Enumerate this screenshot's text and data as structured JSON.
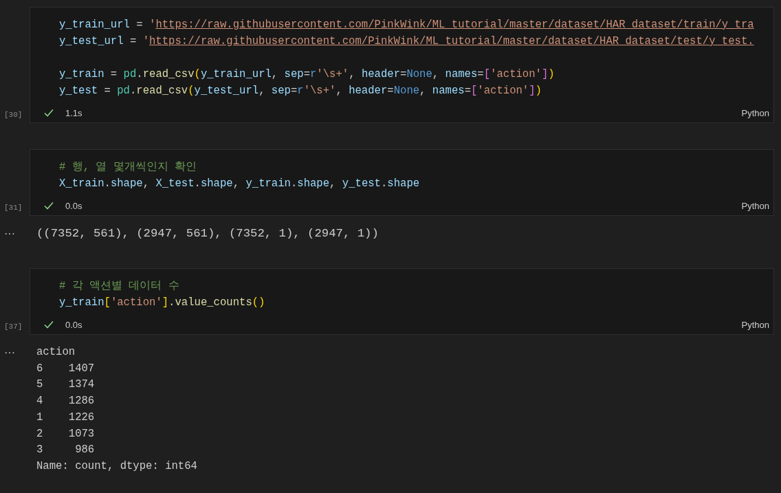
{
  "cells": [
    {
      "execution_count": "[30]",
      "lines": [
        {
          "kind": "code",
          "tokens": [
            {
              "kind": "var",
              "t": "y_train_url"
            },
            {
              "kind": "op",
              "t": " = "
            },
            {
              "kind": "str",
              "t": "'"
            },
            {
              "kind": "link",
              "t": "https://raw.githubusercontent.com/PinkWink/ML_tutorial/master/dataset/HAR_dataset/train/y_tra"
            }
          ]
        },
        {
          "kind": "code",
          "tokens": [
            {
              "kind": "var",
              "t": "y_test_url"
            },
            {
              "kind": "op",
              "t": " = "
            },
            {
              "kind": "str",
              "t": "'"
            },
            {
              "kind": "link",
              "t": "https://raw.githubusercontent.com/PinkWink/ML_tutorial/master/dataset/HAR_dataset/test/y_test."
            }
          ]
        },
        {
          "kind": "blank"
        },
        {
          "kind": "code",
          "tokens": [
            {
              "kind": "var",
              "t": "y_train"
            },
            {
              "kind": "op",
              "t": " = "
            },
            {
              "kind": "type",
              "t": "pd"
            },
            {
              "kind": "op",
              "t": "."
            },
            {
              "kind": "func",
              "t": "read_csv"
            },
            {
              "kind": "b1",
              "t": "("
            },
            {
              "kind": "var",
              "t": "y_train_url"
            },
            {
              "kind": "op",
              "t": ", "
            },
            {
              "kind": "var",
              "t": "sep"
            },
            {
              "kind": "op",
              "t": "="
            },
            {
              "kind": "kw",
              "t": "r"
            },
            {
              "kind": "str",
              "t": "'\\s+'"
            },
            {
              "kind": "op",
              "t": ", "
            },
            {
              "kind": "var",
              "t": "header"
            },
            {
              "kind": "op",
              "t": "="
            },
            {
              "kind": "kw",
              "t": "None"
            },
            {
              "kind": "op",
              "t": ", "
            },
            {
              "kind": "var",
              "t": "names"
            },
            {
              "kind": "op",
              "t": "="
            },
            {
              "kind": "b2",
              "t": "["
            },
            {
              "kind": "str",
              "t": "'action'"
            },
            {
              "kind": "b2",
              "t": "]"
            },
            {
              "kind": "b1",
              "t": ")"
            }
          ]
        },
        {
          "kind": "code",
          "tokens": [
            {
              "kind": "var",
              "t": "y_test"
            },
            {
              "kind": "op",
              "t": " = "
            },
            {
              "kind": "type",
              "t": "pd"
            },
            {
              "kind": "op",
              "t": "."
            },
            {
              "kind": "func",
              "t": "read_csv"
            },
            {
              "kind": "b1",
              "t": "("
            },
            {
              "kind": "var",
              "t": "y_test_url"
            },
            {
              "kind": "op",
              "t": ", "
            },
            {
              "kind": "var",
              "t": "sep"
            },
            {
              "kind": "op",
              "t": "="
            },
            {
              "kind": "kw",
              "t": "r"
            },
            {
              "kind": "str",
              "t": "'\\s+'"
            },
            {
              "kind": "op",
              "t": ", "
            },
            {
              "kind": "var",
              "t": "header"
            },
            {
              "kind": "op",
              "t": "="
            },
            {
              "kind": "kw",
              "t": "None"
            },
            {
              "kind": "op",
              "t": ", "
            },
            {
              "kind": "var",
              "t": "names"
            },
            {
              "kind": "op",
              "t": "="
            },
            {
              "kind": "b2",
              "t": "["
            },
            {
              "kind": "str",
              "t": "'action'"
            },
            {
              "kind": "b2",
              "t": "]"
            },
            {
              "kind": "b1",
              "t": ")"
            }
          ]
        }
      ],
      "succeeded": true,
      "duration": "1.1s",
      "language": "Python"
    },
    {
      "execution_count": "[31]",
      "lines": [
        {
          "kind": "code",
          "tokens": [
            {
              "kind": "comment",
              "t": "# 행, 열 몇개씩인지 확인"
            }
          ]
        },
        {
          "kind": "code",
          "tokens": [
            {
              "kind": "var",
              "t": "X_train"
            },
            {
              "kind": "op",
              "t": "."
            },
            {
              "kind": "var",
              "t": "shape"
            },
            {
              "kind": "op",
              "t": ", "
            },
            {
              "kind": "var",
              "t": "X_test"
            },
            {
              "kind": "op",
              "t": "."
            },
            {
              "kind": "var",
              "t": "shape"
            },
            {
              "kind": "op",
              "t": ", "
            },
            {
              "kind": "var",
              "t": "y_train"
            },
            {
              "kind": "op",
              "t": "."
            },
            {
              "kind": "var",
              "t": "shape"
            },
            {
              "kind": "op",
              "t": ", "
            },
            {
              "kind": "var",
              "t": "y_test"
            },
            {
              "kind": "op",
              "t": "."
            },
            {
              "kind": "var",
              "t": "shape"
            }
          ]
        }
      ],
      "succeeded": true,
      "duration": "0.0s",
      "language": "Python",
      "output": {
        "menu": "···",
        "lines": [
          "((7352, 561), (2947, 561), (7352, 1), (2947, 1))"
        ]
      }
    },
    {
      "execution_count": "[37]",
      "lines": [
        {
          "kind": "code",
          "tokens": [
            {
              "kind": "comment",
              "t": "# 각 액션별 데이터 수"
            }
          ]
        },
        {
          "kind": "code",
          "tokens": [
            {
              "kind": "var",
              "t": "y_train"
            },
            {
              "kind": "b1",
              "t": "["
            },
            {
              "kind": "str",
              "t": "'action'"
            },
            {
              "kind": "b1",
              "t": "]"
            },
            {
              "kind": "op",
              "t": "."
            },
            {
              "kind": "func",
              "t": "value_counts"
            },
            {
              "kind": "b1",
              "t": "()"
            }
          ]
        }
      ],
      "succeeded": true,
      "duration": "0.0s",
      "language": "Python",
      "output": {
        "menu": "···",
        "lines": [
          "action",
          "6    1407",
          "5    1374",
          "4    1286",
          "1    1226",
          "2    1073",
          "3     986",
          "Name: count, dtype: int64"
        ]
      }
    }
  ]
}
